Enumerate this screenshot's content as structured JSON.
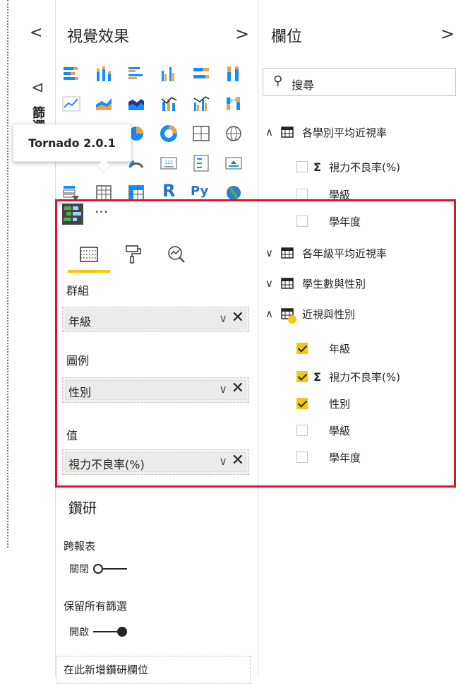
{
  "filters": {
    "collapse_chevron": "<",
    "pane_label": "篩選"
  },
  "visuals": {
    "title": "視覺效果",
    "expand_chevron": ">",
    "tooltip": "Tornado 2.0.1",
    "more": "···",
    "r_label": "R",
    "py_label": "Py",
    "sections": {
      "group": "群組",
      "legend": "圖例",
      "values": "值"
    },
    "wells": {
      "group_value": "年級",
      "legend_value": "性別",
      "values_value": "視力不良率(%)"
    },
    "drill": {
      "title": "鑽研",
      "cross_report_label": "跨報表",
      "cross_report_state": "關閉",
      "keep_filters_label": "保留所有篩選",
      "keep_filters_state": "開啟",
      "drop_placeholder": "在此新增鑽研欄位"
    }
  },
  "fields": {
    "title": "欄位",
    "expand_chevron": ">",
    "search_placeholder": "搜尋",
    "tables": [
      {
        "name": "各學別平均近視率",
        "expanded": true,
        "fields": [
          {
            "name": "視力不良率(%)",
            "sigma": true,
            "checked": false
          },
          {
            "name": "學級",
            "sigma": false,
            "checked": false
          },
          {
            "name": "學年度",
            "sigma": false,
            "checked": false
          }
        ]
      },
      {
        "name": "各年級平均近視率",
        "expanded": false
      },
      {
        "name": "學生數與性別",
        "expanded": false
      },
      {
        "name": "近視與性別",
        "expanded": true,
        "fields": [
          {
            "name": "年級",
            "sigma": false,
            "checked": true
          },
          {
            "name": "視力不良率(%)",
            "sigma": true,
            "checked": true
          },
          {
            "name": "性別",
            "sigma": false,
            "checked": true
          },
          {
            "name": "學級",
            "sigma": false,
            "checked": false
          },
          {
            "name": "學年度",
            "sigma": false,
            "checked": false
          }
        ]
      }
    ]
  },
  "colors": {
    "accent_yellow": "#f2c811",
    "highlight_red": "#e81123",
    "pane_separator": "#e1dfdd"
  }
}
